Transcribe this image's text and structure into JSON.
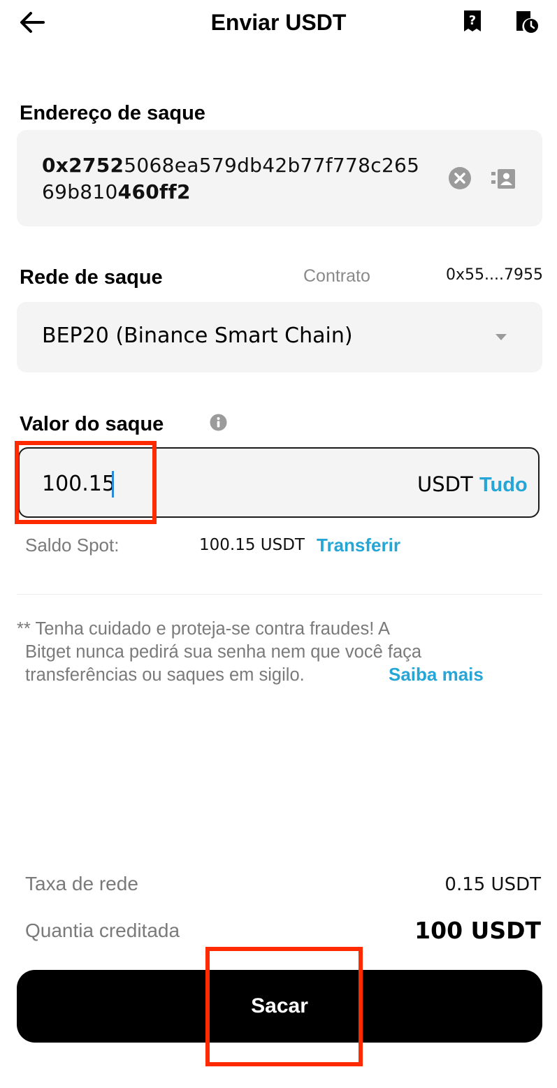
{
  "header": {
    "title": "Enviar USDT",
    "back_icon": "arrow-left-icon",
    "help_icon": "question-doc-icon",
    "history_icon": "history-clock-icon"
  },
  "address": {
    "label": "Endereço de saque",
    "value_start_bold": "0x2752",
    "value_mid": "5068ea579db42b77f778c265",
    "value_line2_regular": "69b810",
    "value_end_bold": "460ff2"
  },
  "network": {
    "label": "Rede de saque",
    "contract_label": "Contrato",
    "contract_value": "0x55....7955",
    "selected": "BEP20 (Binance Smart Chain)"
  },
  "amount": {
    "label": "Valor do saque",
    "value": "100.15",
    "unit": "USDT",
    "all_label": "Tudo"
  },
  "balance": {
    "label": "Saldo Spot:",
    "value": "100.15 USDT",
    "transfer_label": "Transferir"
  },
  "warning": {
    "line1": "** Tenha cuidado e proteja-se contra fraudes! A",
    "line2": "Bitget nunca pedirá sua senha nem que você faça",
    "line3": "transferências ou saques em sigilo.",
    "learn_more": "Saiba mais"
  },
  "summary": {
    "fee_label": "Taxa de rede",
    "fee_value": "0.15 USDT",
    "credited_label": "Quantia creditada",
    "credited_value": "100 USDT"
  },
  "submit_label": "Sacar",
  "colors": {
    "accent_link": "#25a6d6",
    "highlight_box": "#ff2a00",
    "button_bg": "#000000"
  }
}
